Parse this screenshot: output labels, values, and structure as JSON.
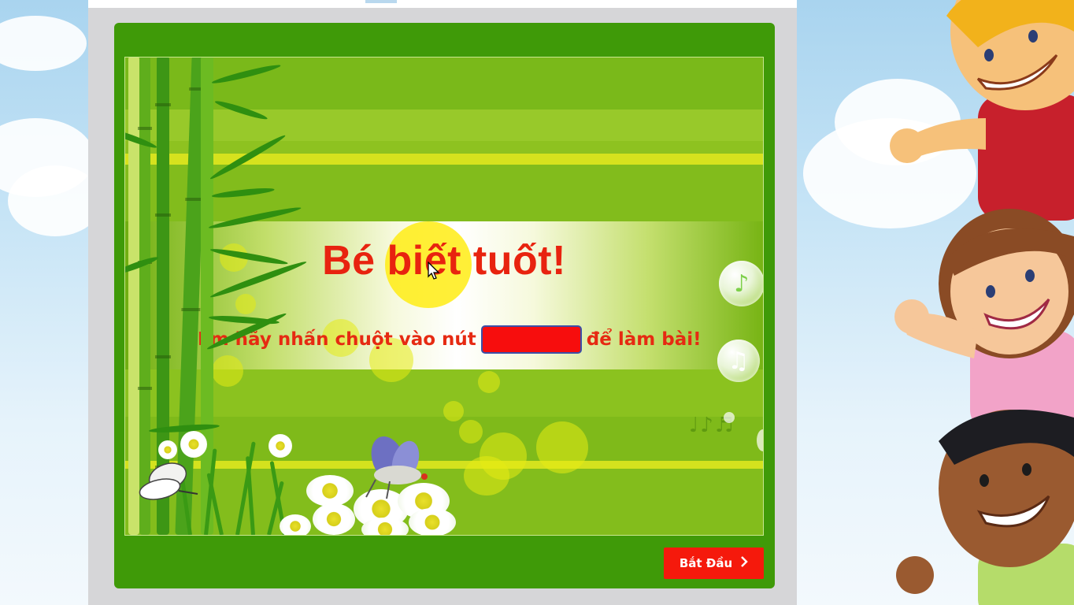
{
  "slide": {
    "title": "Bé biết tuốt!",
    "instruction_before": "Em hãy nhấn chuột vào nút",
    "instruction_after": "để làm bài!"
  },
  "controls": {
    "next_label": "Bắt Đầu",
    "next_icon": "chevron-right-icon"
  },
  "decorations": {
    "music_notes": "♩♪♬"
  },
  "colors": {
    "title": "#e8230f",
    "frame": "#3f9a08",
    "button": "#f5190c"
  }
}
